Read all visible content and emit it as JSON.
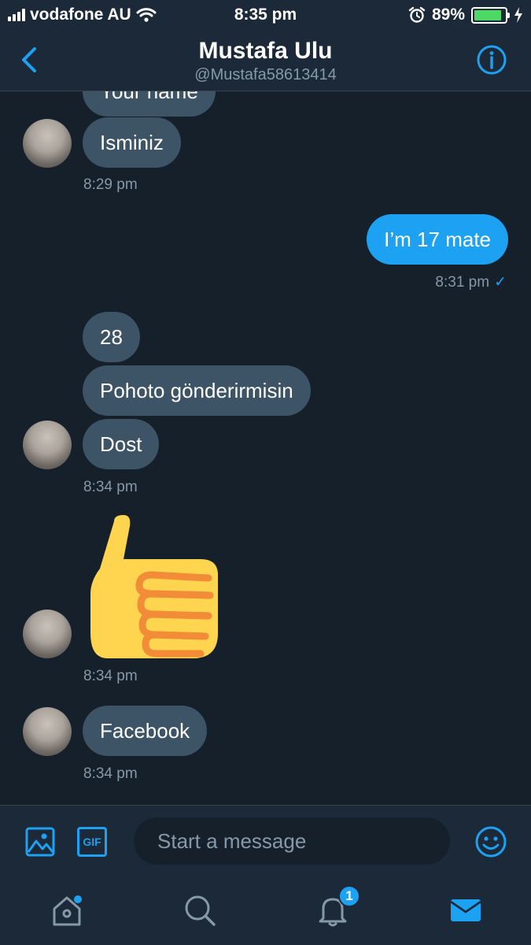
{
  "status_bar": {
    "carrier": "vodafone AU",
    "time": "8:35 pm",
    "battery": "89%",
    "battery_level": 0.89
  },
  "header": {
    "name": "Mustafa Ulu",
    "handle": "@Mustafa58613414"
  },
  "messages": [
    {
      "text": "Your name",
      "direction": "in"
    },
    {
      "text": "Isminiz",
      "direction": "in"
    },
    {
      "time": "8:29 pm"
    },
    {
      "text": "I’m 17 mate",
      "direction": "out"
    },
    {
      "time": "8:31 pm",
      "read": "✓"
    },
    {
      "text": "28",
      "direction": "in"
    },
    {
      "text": "Pohoto gönderirmisin",
      "direction": "in"
    },
    {
      "text": "Dost",
      "direction": "in"
    },
    {
      "time": "8:34 pm"
    },
    {
      "emoji": "thumbs-up"
    },
    {
      "time": "8:34 pm"
    },
    {
      "text": "Facebook",
      "direction": "in"
    },
    {
      "time": "8:34 pm"
    }
  ],
  "composer": {
    "placeholder": "Start a message",
    "gif_label": "GIF"
  },
  "tabbar": {
    "notification_count": "1"
  },
  "colors": {
    "background": "#15202b",
    "bar": "#1c2938",
    "accent": "#1da1f2",
    "incoming_bubble": "#3d5466",
    "muted_text": "#8899a6"
  }
}
